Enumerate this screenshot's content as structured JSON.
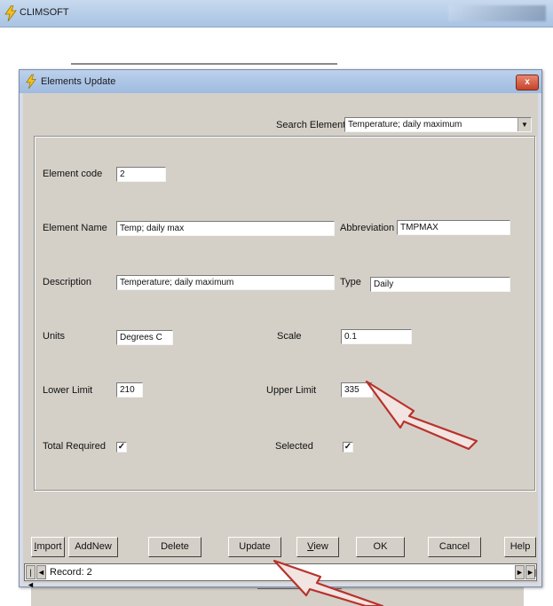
{
  "app": {
    "title": "CLIMSOFT"
  },
  "dialog": {
    "title": "Elements Update",
    "close_label": "x",
    "search": {
      "label": "Search Element",
      "value": "Temperature; daily maximum"
    },
    "fields": {
      "element_code": {
        "label": "Element code",
        "value": "2"
      },
      "element_name": {
        "label": "Element Name",
        "value": "Temp; daily max"
      },
      "abbreviation": {
        "label": "Abbreviation",
        "value": "TMPMAX"
      },
      "description": {
        "label": "Description",
        "value": "Temperature; daily maximum"
      },
      "type": {
        "label": "Type",
        "value": "Daily"
      },
      "units": {
        "label": "Units",
        "value": "Degrees C"
      },
      "scale": {
        "label": "Scale",
        "value": "0.1"
      },
      "lower_limit": {
        "label": "Lower Limit",
        "value": "210"
      },
      "upper_limit": {
        "label": "Upper Limit",
        "value": "335"
      },
      "total_required": {
        "label": "Total Required",
        "checked": true,
        "mark": "✓"
      },
      "selected": {
        "label": "Selected",
        "checked": true,
        "mark": "✓"
      }
    },
    "buttons": {
      "import": "Import",
      "add_new": "AddNew",
      "delete": "Delete",
      "update": "Update",
      "view": "View",
      "ok": "OK",
      "cancel": "Cancel",
      "help": "Help"
    },
    "navigator": {
      "first": "|◄",
      "prev": "◄",
      "label": "Record: 2",
      "next": "►",
      "last": "►|"
    }
  },
  "colors": {
    "annotation_arrow": "#b8322c"
  }
}
